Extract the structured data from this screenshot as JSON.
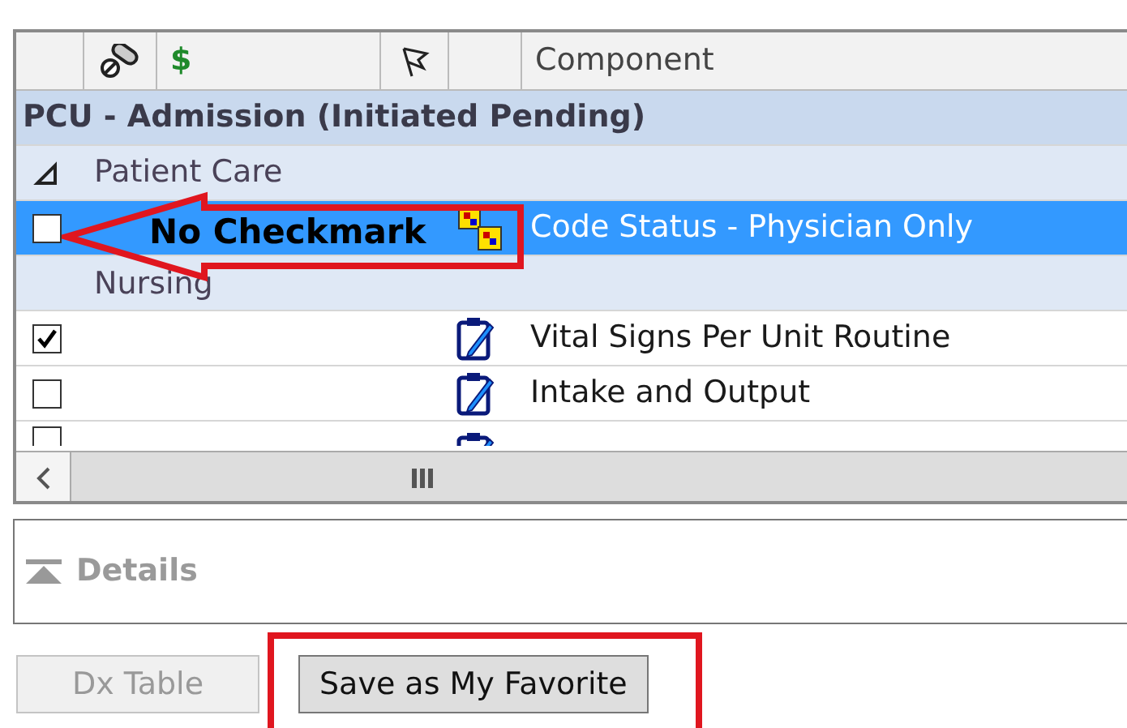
{
  "grid": {
    "header": {
      "column_3": "$",
      "column_6": "Component"
    },
    "rows": [
      {
        "kind": "group",
        "label": "PCU - Admission (Initiated Pending)"
      },
      {
        "kind": "subgroup",
        "label": "Patient Care",
        "expanded": true
      },
      {
        "kind": "order",
        "label": "Code Status - Physician Only",
        "checked": false,
        "selected": true
      },
      {
        "kind": "heading",
        "label": "Nursing"
      },
      {
        "kind": "task",
        "label": "Vital Signs Per Unit Routine",
        "checked": true,
        "selected": false
      },
      {
        "kind": "task",
        "label": "Intake and Output",
        "checked": false,
        "selected": false
      },
      {
        "kind": "clipped-task",
        "checked": false,
        "selected": false
      }
    ]
  },
  "callout": "No Checkmark",
  "details": {
    "label": "Details"
  },
  "buttons": [
    {
      "label": "Dx Table",
      "disabled": true
    },
    {
      "label": "Save as My Favorite",
      "disabled": false
    }
  ]
}
